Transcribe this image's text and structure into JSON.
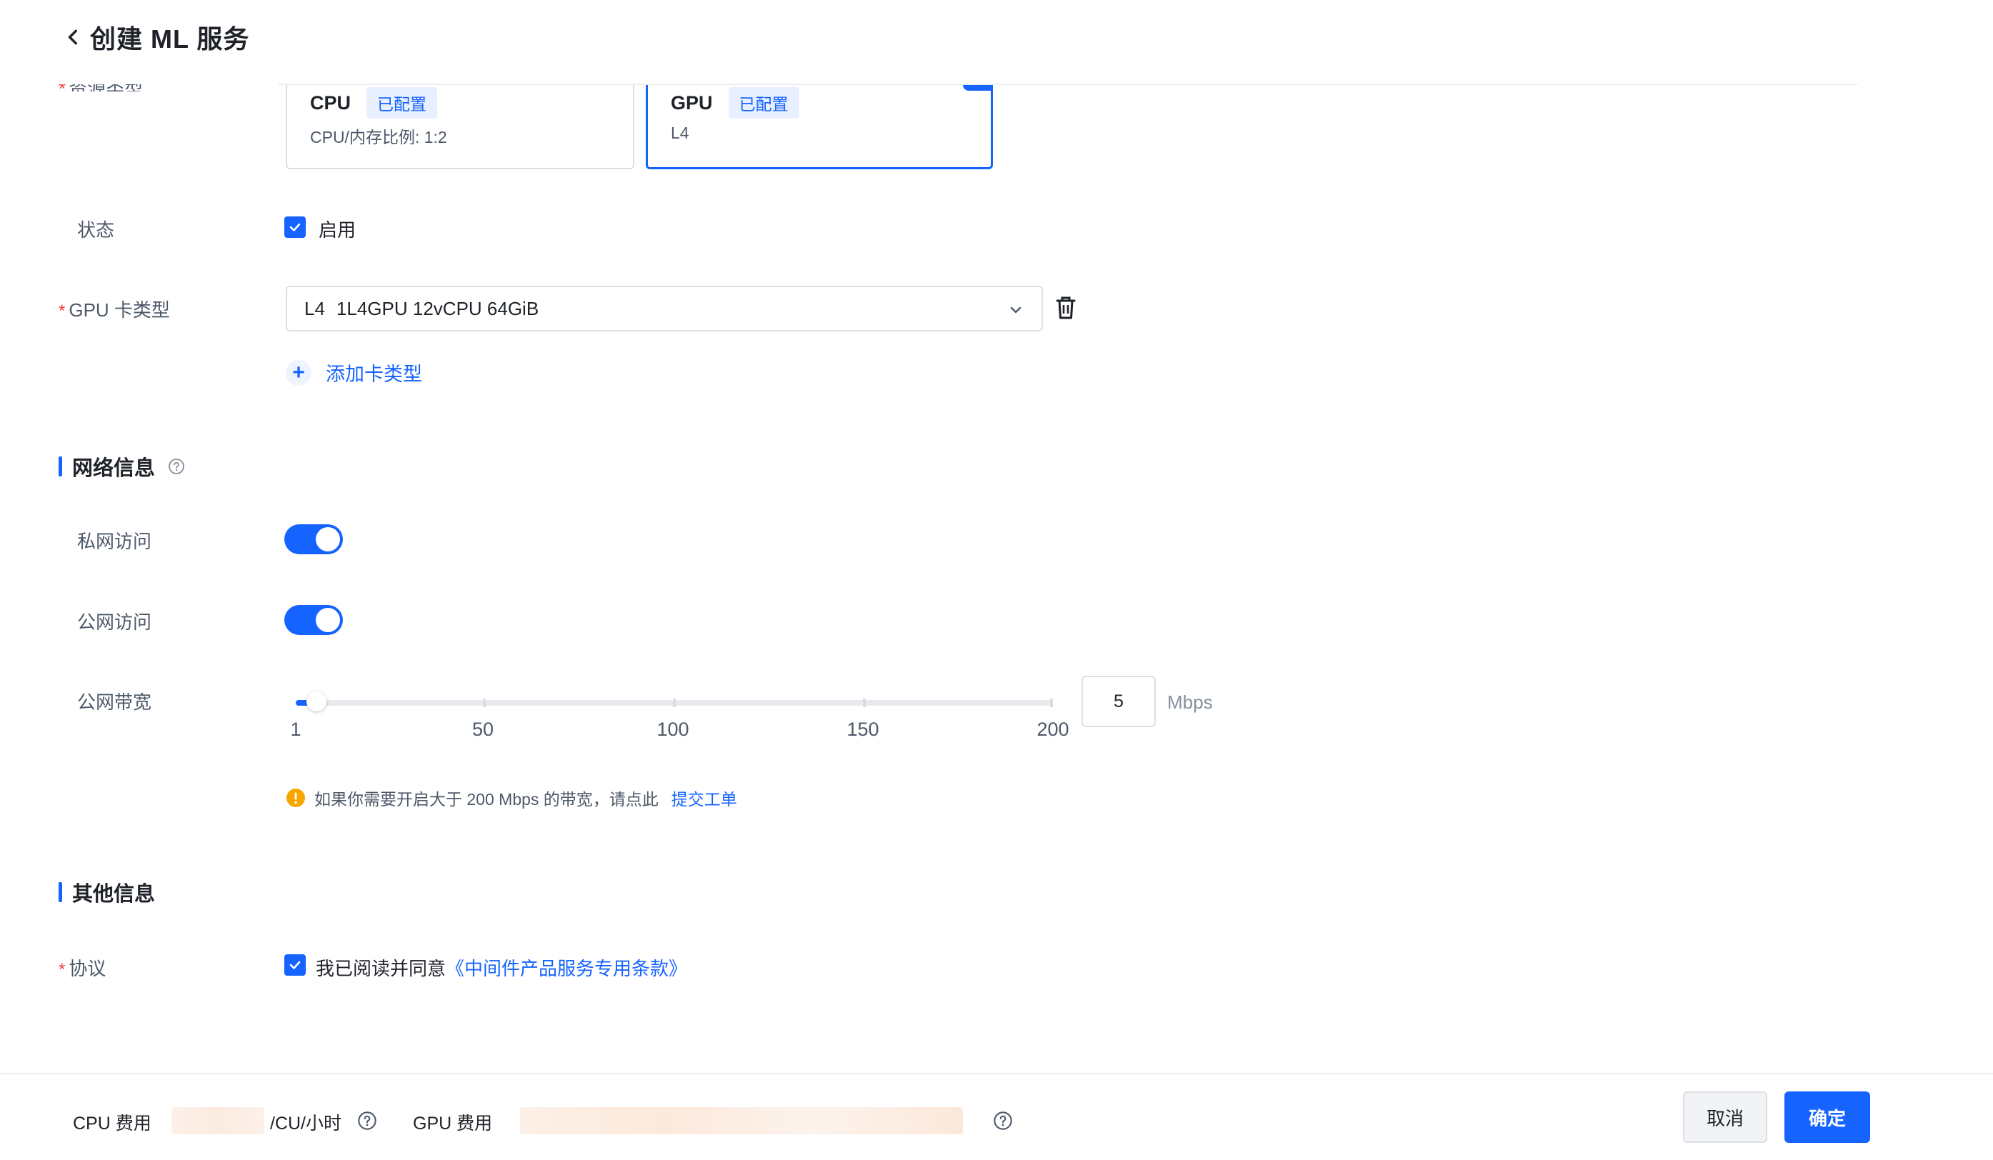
{
  "header": {
    "title": "创建 ML 服务"
  },
  "resource": {
    "label": "资源类型",
    "cpu_card": {
      "name": "CPU",
      "tag": "已配置",
      "detail": "CPU/内存比例: 1:2"
    },
    "gpu_card": {
      "name": "GPU",
      "tag": "已配置",
      "detail": "L4"
    }
  },
  "status": {
    "label": "状态",
    "checkbox_text": "启用",
    "checked": true
  },
  "gpu_type": {
    "label": "GPU 卡类型",
    "selected_code": "L4",
    "selected_spec": "1L4GPU 12vCPU 64GiB",
    "add_label": "添加卡类型"
  },
  "network": {
    "section_title": "网络信息",
    "private_access": {
      "label": "私网访问",
      "enabled": true
    },
    "public_access": {
      "label": "公网访问",
      "enabled": true
    },
    "bandwidth": {
      "label": "公网带宽",
      "value": "5",
      "unit": "Mbps",
      "min": 1,
      "max": 200,
      "ticks": [
        "1",
        "50",
        "100",
        "150",
        "200"
      ],
      "warning": "如果你需要开启大于 200 Mbps 的带宽，请点此",
      "warning_link": "提交工单"
    }
  },
  "other": {
    "section_title": "其他信息",
    "agreement": {
      "label": "协议",
      "text": "我已阅读并同意",
      "link": "《中间件产品服务专用条款》",
      "checked": true
    }
  },
  "footer": {
    "cpu_fee_label": "CPU 费用",
    "cpu_fee_unit": "/CU/小时",
    "gpu_fee_label": "GPU 费用",
    "cancel_label": "取消",
    "confirm_label": "确定"
  },
  "colors": {
    "primary": "#1664ff",
    "required": "#f53f3f",
    "warning": "#f7a600"
  }
}
